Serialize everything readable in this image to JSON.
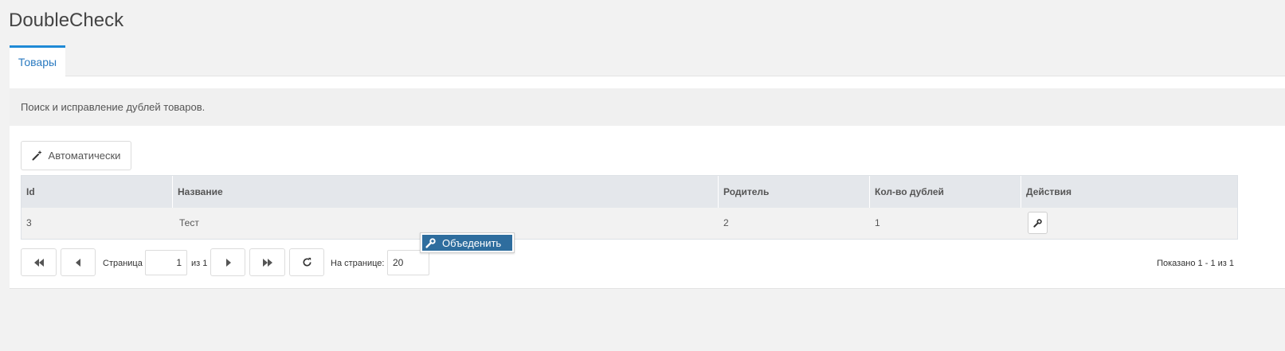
{
  "app": {
    "title": "DoubleCheck"
  },
  "tabs": [
    {
      "label": "Товары",
      "active": true
    }
  ],
  "description": "Поиск и исправление дублей товаров.",
  "toolbar": {
    "auto_label": "Автоматически",
    "auto_icon": "magic-wand-icon"
  },
  "grid": {
    "columns": [
      "Id",
      "Название",
      "Родитель",
      "Кол-во дублей",
      "Действия"
    ],
    "rows": [
      {
        "id": "3",
        "name": "Тест",
        "parent": "2",
        "dup_count": "1",
        "action_icon": "wrench-icon"
      }
    ]
  },
  "context_menu": {
    "items": [
      {
        "label": "Объеденить",
        "icon": "wrench-icon"
      }
    ]
  },
  "pager": {
    "page_label": "Страница",
    "page_value": "1",
    "of_label": "из 1",
    "per_page_label": "На странице:",
    "per_page_value": "20",
    "summary": "Показано 1 - 1 из 1"
  },
  "colors": {
    "accent": "#1f8ad6",
    "menu_highlight": "#2e6d9e",
    "header_bg": "#e4e7eb",
    "page_bg": "#f2f2f2"
  }
}
